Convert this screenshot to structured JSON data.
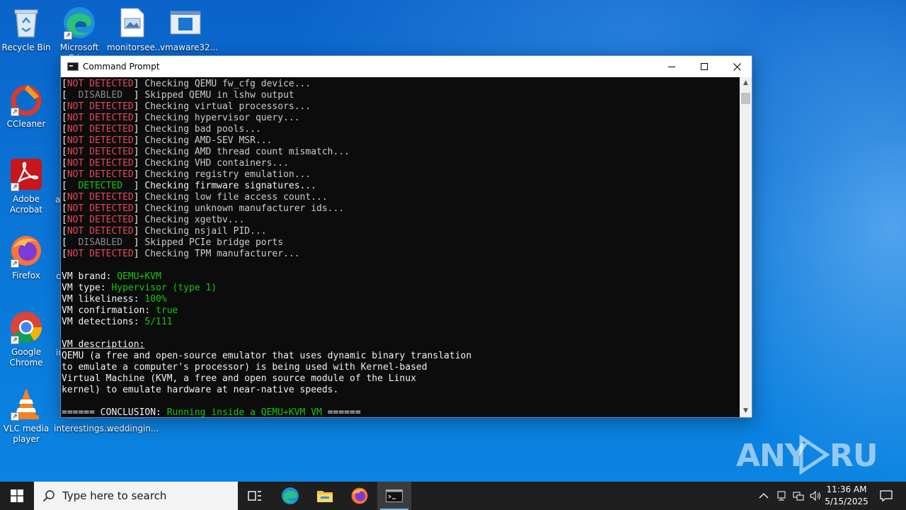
{
  "desktop": {
    "icons": [
      {
        "label": "Recycle Bin"
      },
      {
        "label": "Microsoft Edge"
      },
      {
        "label": "monitorsee..."
      },
      {
        "label": "vmaware32..."
      },
      {
        "label": "CCleaner"
      },
      {
        "label": "Adobe Acrobat"
      },
      {
        "label": "Firefox"
      },
      {
        "label": "Google Chrome"
      },
      {
        "label": "VLC media player"
      },
      {
        "label": "interestings..."
      },
      {
        "label": "weddingin..."
      }
    ],
    "partial_labels": [
      "ar",
      "c",
      "ir"
    ]
  },
  "window": {
    "title": "Command Prompt",
    "minimize": "—",
    "maximize": "☐",
    "close": "✕",
    "console_lines": [
      {
        "tag": "NOT DETECTED",
        "tag_color": "red",
        "text": "Checking QEMU fw_cfg device..."
      },
      {
        "tag": "  DISABLED  ",
        "tag_color": "gray",
        "text": "Skipped QEMU in lshw output"
      },
      {
        "tag": "NOT DETECTED",
        "tag_color": "red",
        "text": "Checking virtual processors..."
      },
      {
        "tag": "NOT DETECTED",
        "tag_color": "red",
        "text": "Checking hypervisor query..."
      },
      {
        "tag": "NOT DETECTED",
        "tag_color": "red",
        "text": "Checking bad pools..."
      },
      {
        "tag": "NOT DETECTED",
        "tag_color": "red",
        "text": "Checking AMD-SEV MSR..."
      },
      {
        "tag": "NOT DETECTED",
        "tag_color": "red",
        "text": "Checking AMD thread count mismatch..."
      },
      {
        "tag": "NOT DETECTED",
        "tag_color": "red",
        "text": "Checking VHD containers..."
      },
      {
        "tag": "NOT DETECTED",
        "tag_color": "red",
        "text": "Checking registry emulation..."
      },
      {
        "tag": "  DETECTED  ",
        "tag_color": "green",
        "text": "Checking firmware signatures..."
      },
      {
        "tag": "NOT DETECTED",
        "tag_color": "red",
        "text": "Checking low file access count..."
      },
      {
        "tag": "NOT DETECTED",
        "tag_color": "red",
        "text": "Checking unknown manufacturer ids..."
      },
      {
        "tag": "NOT DETECTED",
        "tag_color": "red",
        "text": "Checking xgetbv..."
      },
      {
        "tag": "NOT DETECTED",
        "tag_color": "red",
        "text": "Checking nsjail PID..."
      },
      {
        "tag": "  DISABLED  ",
        "tag_color": "gray",
        "text": "Skipped PCIe bridge ports"
      },
      {
        "tag": "NOT DETECTED",
        "tag_color": "red",
        "text": "Checking TPM manufacturer..."
      }
    ],
    "summary": [
      {
        "key": "VM brand: ",
        "value": "QEMU+KVM"
      },
      {
        "key": "VM type: ",
        "value": "Hypervisor (type 1)"
      },
      {
        "key": "VM likeliness: ",
        "value": "100%"
      },
      {
        "key": "VM confirmation: ",
        "value": "true"
      },
      {
        "key": "VM detections: ",
        "value": "5/111"
      }
    ],
    "description_heading": "VM description:",
    "description_lines": [
      "QEMU (a free and open-source emulator that uses dynamic binary translation",
      "to emulate a computer's processor) is being used with Kernel-based",
      "Virtual Machine (KVM, a free and open source module of the Linux",
      "kernel) to emulate hardware at near-native speeds."
    ],
    "conclusion_prefix": "====== CONCLUSION: ",
    "conclusion_value": "Running inside a QEMU+KVM VM",
    "conclusion_suffix": " ======"
  },
  "watermark": "ANY RUN",
  "taskbar": {
    "search_placeholder": "Type here to search",
    "time": "11:36 AM",
    "date": "5/15/2025"
  },
  "colors": {
    "red": "#e74856",
    "green": "#16c60c",
    "gray": "#8a8a8a",
    "accent": "#0a74d6"
  }
}
